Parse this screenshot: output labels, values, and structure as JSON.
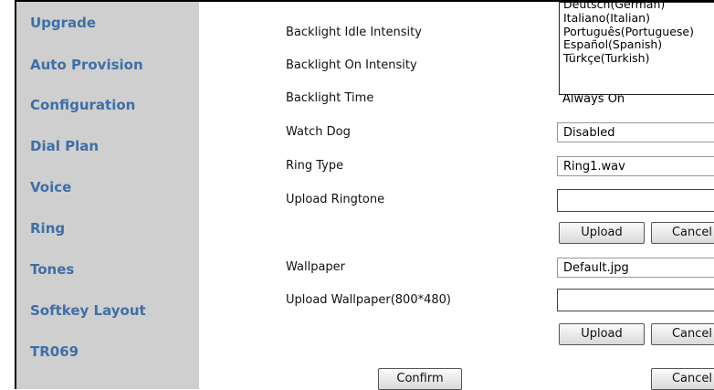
{
  "sidebar": {
    "items": [
      {
        "label": "Upgrade"
      },
      {
        "label": "Auto Provision"
      },
      {
        "label": "Configuration"
      },
      {
        "label": "Dial Plan"
      },
      {
        "label": "Voice"
      },
      {
        "label": "Ring"
      },
      {
        "label": "Tones"
      },
      {
        "label": "Softkey Layout"
      },
      {
        "label": "TR069"
      }
    ]
  },
  "form": {
    "backlight_idle_intensity": {
      "label": "Backlight Idle Intensity"
    },
    "backlight_on_intensity": {
      "label": "Backlight On Intensity"
    },
    "backlight_time": {
      "label": "Backlight Time",
      "value": "Always On"
    },
    "watch_dog": {
      "label": "Watch Dog",
      "value": "Disabled"
    },
    "ring_type": {
      "label": "Ring Type",
      "value": "Ring1.wav"
    },
    "upload_ringtone": {
      "label": "Upload Ringtone",
      "value": "",
      "upload_label": "Upload",
      "cancel_label": "Cancel"
    },
    "wallpaper": {
      "label": "Wallpaper",
      "value": "Default.jpg"
    },
    "upload_wallpaper": {
      "label": "Upload Wallpaper(800*480)",
      "value": "",
      "upload_label": "Upload",
      "cancel_label": "Cancel"
    },
    "confirm_label": "Confirm",
    "cancel_label": "Cancel"
  },
  "language_dropdown": {
    "options": [
      "Deutsch(German)",
      "Italiano(Italian)",
      "Português(Portuguese)",
      "Español(Spanish)",
      "Türkçe(Turkish)"
    ]
  }
}
